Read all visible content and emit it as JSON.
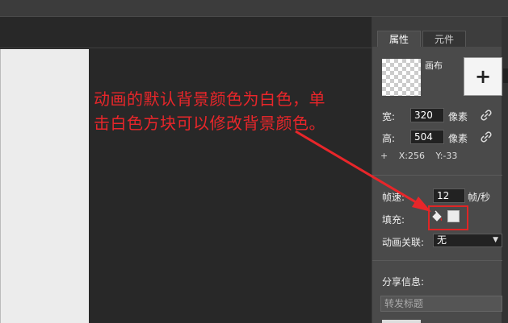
{
  "annotation": {
    "line1": "动画的默认背景颜色为白色，单",
    "line2": "击白色方块可以修改背景颜色。"
  },
  "tabs": [
    {
      "label": "属性",
      "active": true
    },
    {
      "label": "元件",
      "active": false
    }
  ],
  "canvas": {
    "label": "画布",
    "add_label": "+"
  },
  "size": {
    "width_label": "宽:",
    "width_value": "320",
    "height_label": "高:",
    "height_value": "504",
    "unit": "像素"
  },
  "position": {
    "prefix": "+",
    "x": "X:256",
    "y": "Y:-33"
  },
  "framerate": {
    "label": "帧速:",
    "value": "12",
    "unit": "帧/秒"
  },
  "fill": {
    "label": "填充:",
    "color": "#ececec"
  },
  "anim_link": {
    "label": "动画关联:",
    "value": "无"
  },
  "share": {
    "label": "分享信息:",
    "placeholder": "转发标题"
  },
  "colors": {
    "annotation_red": "#e8262a",
    "panel_bg": "#4a4a4a"
  }
}
